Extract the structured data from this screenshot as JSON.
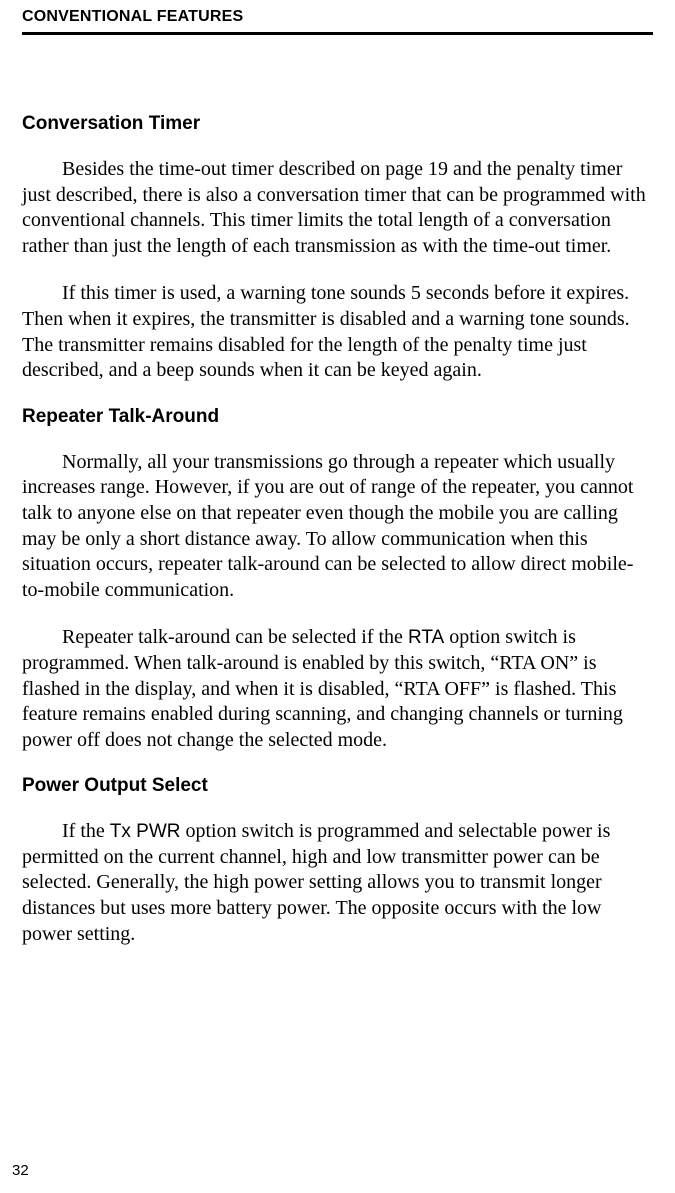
{
  "header": {
    "running_head": "CONVENTIONAL FEATURES"
  },
  "sections": {
    "conv_timer": {
      "heading": "Conversation Timer",
      "p1": "Besides the time-out timer described on page 19 and the penalty timer just described, there is also a conversation timer that can be programmed with conventional channels. This timer limits the total length of a conversation rather than just the length of each transmission as with the time-out timer.",
      "p2": "If this timer is used, a warning tone sounds 5 seconds before it expires. Then when it expires, the transmitter is disabled and a warning tone sounds. The transmitter remains disabled for the length of the penalty time just described, and a beep sounds when it can be keyed again."
    },
    "rta": {
      "heading": "Repeater Talk-Around",
      "p1": "Normally, all your transmissions go through a repeater which usually increases range. However, if you are out of range of the repeater, you cannot talk to anyone else on that repeater even though the mobile you are calling may be only a short distance away. To allow communica­tion when this situation occurs, repeater talk-around can be selected to allow direct mobile-to-mobile communication.",
      "p2a": "Repeater talk-around can be selected if the ",
      "p2_opt": "RTA",
      "p2b": " option switch is programmed. When talk-around is enabled by this switch, “RTA ON” is flashed in the display, and when it is disabled, “RTA OFF” is flashed. This feature remains enabled during scanning, and changing channels or turning power off does not change the selected mode."
    },
    "power": {
      "heading": "Power Output Select",
      "p1a": "If the ",
      "p1_opt": "Tx PWR",
      "p1b": " option switch is programmed and selectable power is permitted on the current channel, high and low transmitter power can be selected. Generally, the high power setting allows you to transmit longer distances but uses more battery power. The opposite occurs with the low power setting."
    }
  },
  "page_number": "32"
}
